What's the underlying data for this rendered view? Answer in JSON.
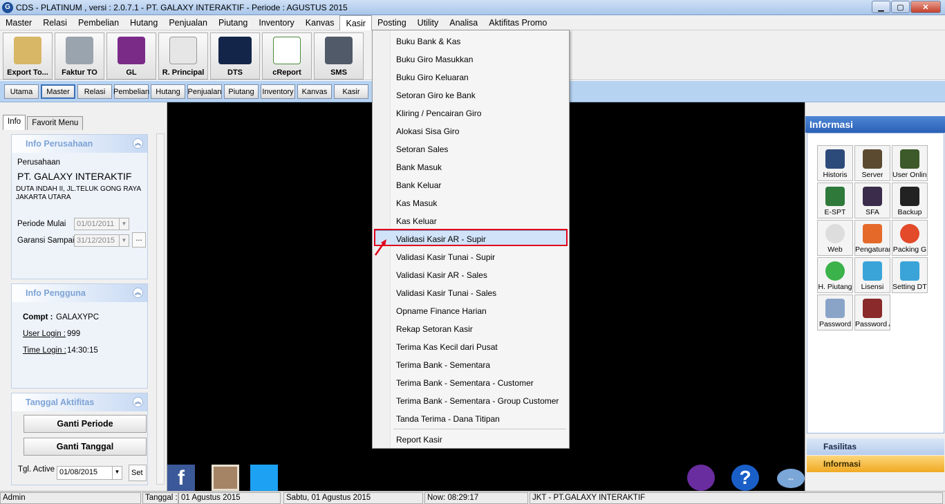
{
  "window": {
    "title": "CDS - PLATINUM , versi : 2.0.7.1  -  PT. GALAXY INTERAKTIF - Periode : AGUSTUS 2015",
    "min": "▁",
    "max": "▢",
    "close": "✕"
  },
  "menubar": [
    "Master",
    "Relasi",
    "Pembelian",
    "Hutang",
    "Penjualan",
    "Piutang",
    "Inventory",
    "Kanvas",
    "Kasir",
    "Posting",
    "Utility",
    "Analisa",
    "Aktifitas Promo"
  ],
  "toolbar": [
    "Export To...",
    "Faktur TO",
    "GL",
    "R. Principal",
    "DTS",
    "cReport",
    "SMS"
  ],
  "subbar": [
    "Utama",
    "Master",
    "Relasi",
    "Pembelian",
    "Hutang",
    "Penjualan",
    "Piutang",
    "Inventory",
    "Kanvas",
    "Kasir"
  ],
  "left": {
    "tabs": [
      "Info",
      "Favorit Menu"
    ],
    "perusahaan": {
      "header": "Info Perusahaan",
      "label": "Perusahaan",
      "name": "PT. GALAXY INTERAKTIF",
      "addr1": "DUTA INDAH II, JL.TELUK GONG RAYA",
      "addr2": "JAKARTA UTARA",
      "periode_label": "Periode Mulai",
      "periode_value": "01/01/2011",
      "garansi_label": "Garansi Sampai",
      "garansi_value": "31/12/2015",
      "more": "..."
    },
    "pengguna": {
      "header": "Info Pengguna",
      "compt_label": "Compt :",
      "compt_value": "GALAXYPC",
      "user_label": "User Login :",
      "user_value": "999",
      "time_label": "Time  Login :",
      "time_value": "14:30:15"
    },
    "aktifitas": {
      "header": "Tanggal Aktifitas",
      "btn_periode": "Ganti Periode",
      "btn_tanggal": "Ganti Tanggal",
      "tgl_label": "Tgl. Active",
      "tgl_value": "01/08/2015",
      "set": "Set"
    }
  },
  "kasir_menu": [
    "Buku Bank & Kas",
    "Buku Giro Masukkan",
    "Buku Giro Keluaran",
    "Setoran Giro ke Bank",
    "Kliring / Pencairan Giro",
    "Alokasi Sisa Giro",
    "Setoran Sales",
    "Bank Masuk",
    "Bank Keluar",
    "Kas Masuk",
    "Kas Keluar",
    "Validasi Kasir AR - Supir",
    "Validasi Kasir Tunai - Supir",
    "Validasi Kasir AR - Sales",
    "Validasi Kasir Tunai - Sales",
    "Opname Finance Harian",
    "Rekap Setoran Kasir",
    "Terima Kas Kecil dari Pusat",
    "Terima Bank - Sementara",
    "Terima Bank - Sementara - Customer",
    "Terima Bank - Sementara - Group Customer",
    "Tanda Terima - Dana Titipan",
    "Report Kasir"
  ],
  "right": {
    "header": "Informasi",
    "icons": [
      "Historis",
      "Server",
      "User Online",
      "E-SPT",
      "SFA",
      "Backup",
      "Web",
      "Pengaturan",
      "Packing G",
      "H. Piutang",
      "Lisensi",
      "Setting DTS",
      "Password",
      "Password Ac"
    ],
    "footer": [
      "Fasilitas",
      "Informasi"
    ]
  },
  "social": {
    "facebook": "f"
  },
  "status": {
    "user": "Admin",
    "tanggal_label": "Tanggal :",
    "tanggal_value": "01 Agustus 2015",
    "hari": "Sabtu, 01 Agustus 2015",
    "now": "Now: 08:29:17",
    "company": "JKT - PT.GALAXY INTERAKTIF"
  },
  "colors": {
    "highlight_box": "#e0001a",
    "header_blue": "#2a60b6",
    "subbar": "#b7d3f2"
  }
}
